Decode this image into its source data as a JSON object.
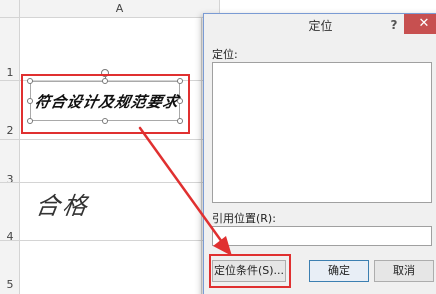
{
  "sheet": {
    "column_header": "A",
    "row_numbers": [
      "1",
      "2",
      "3",
      "4",
      "5"
    ],
    "signature_text": "符合设计及规范要求",
    "handwritten_text": "合格"
  },
  "dialog": {
    "title": "定位",
    "help_label": "?",
    "close_label": "✕",
    "goto_label": "定位:",
    "reference_label": "引用位置(R):",
    "reference_value": "",
    "buttons": {
      "special": "定位条件(S)...",
      "ok": "确定",
      "cancel": "取消"
    }
  },
  "annotation": {
    "highlight_color": "#e03030"
  }
}
